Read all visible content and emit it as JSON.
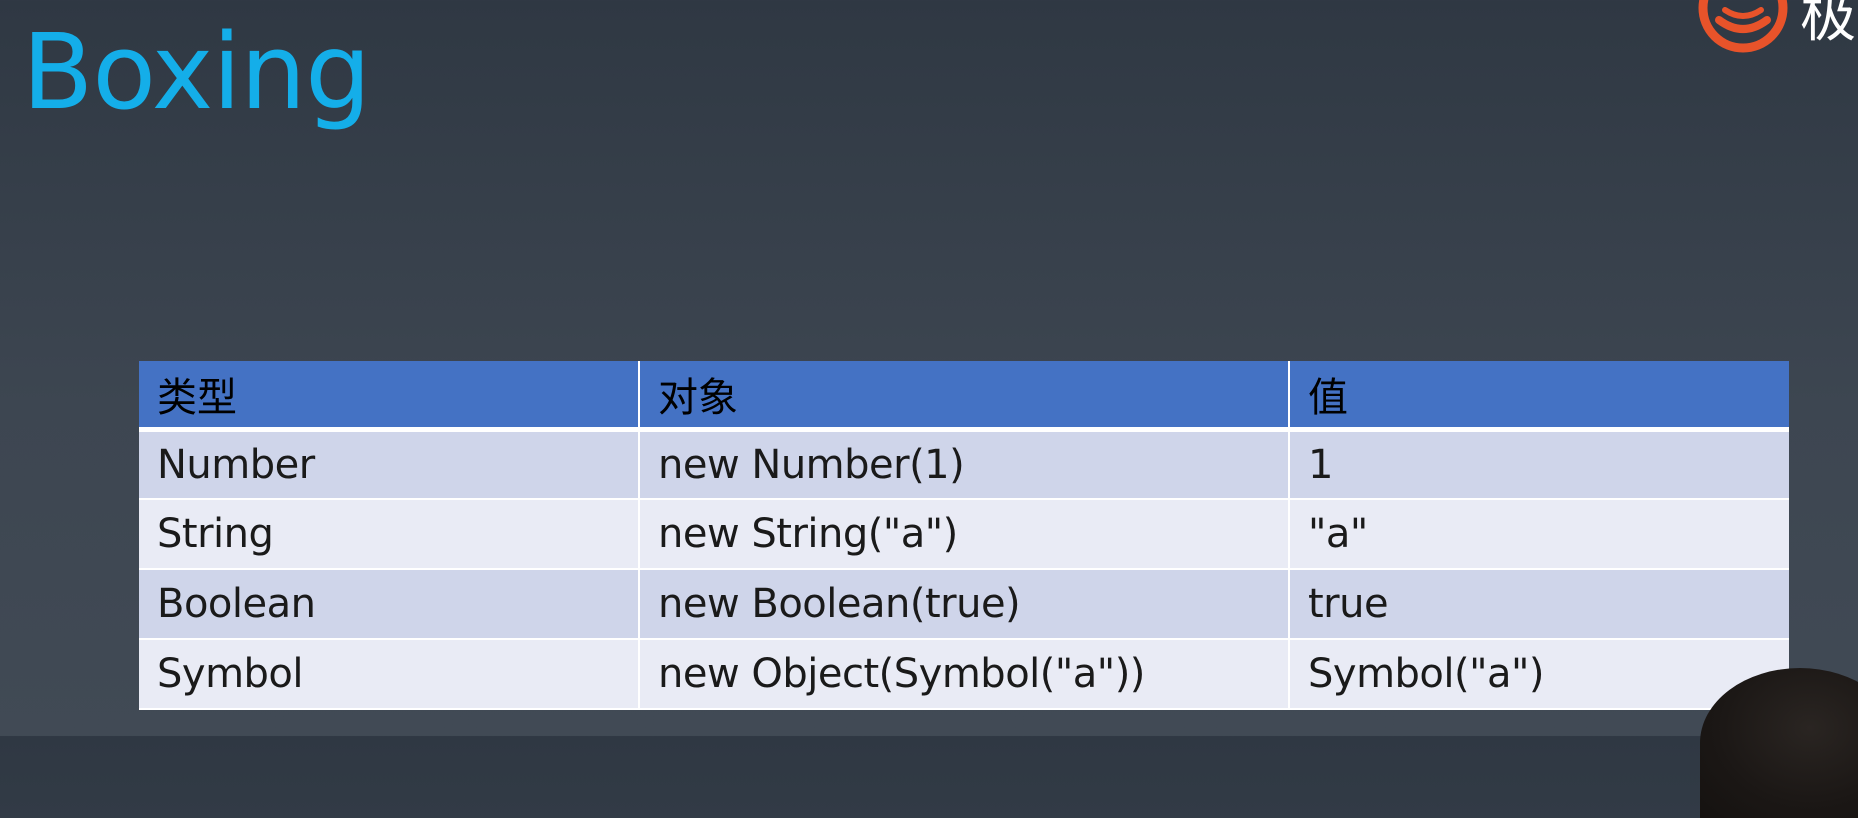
{
  "slide": {
    "title": "Boxing"
  },
  "logo": {
    "char": "极"
  },
  "table": {
    "headers": [
      "类型",
      "对象",
      "值"
    ],
    "rows": [
      [
        "Number",
        "new Number(1)",
        "1"
      ],
      [
        "String",
        "new String(\"a\")",
        "\"a\""
      ],
      [
        "Boolean",
        "new Boolean(true)",
        "true"
      ],
      [
        "Symbol",
        "new Object(Symbol(\"a\"))",
        "Symbol(\"a\")"
      ]
    ]
  },
  "colors": {
    "title": "#14aee9",
    "header_bg": "#4472c4",
    "row_odd": "#cfd5ea",
    "row_even": "#e9ebf5",
    "logo": "#e8532a"
  }
}
